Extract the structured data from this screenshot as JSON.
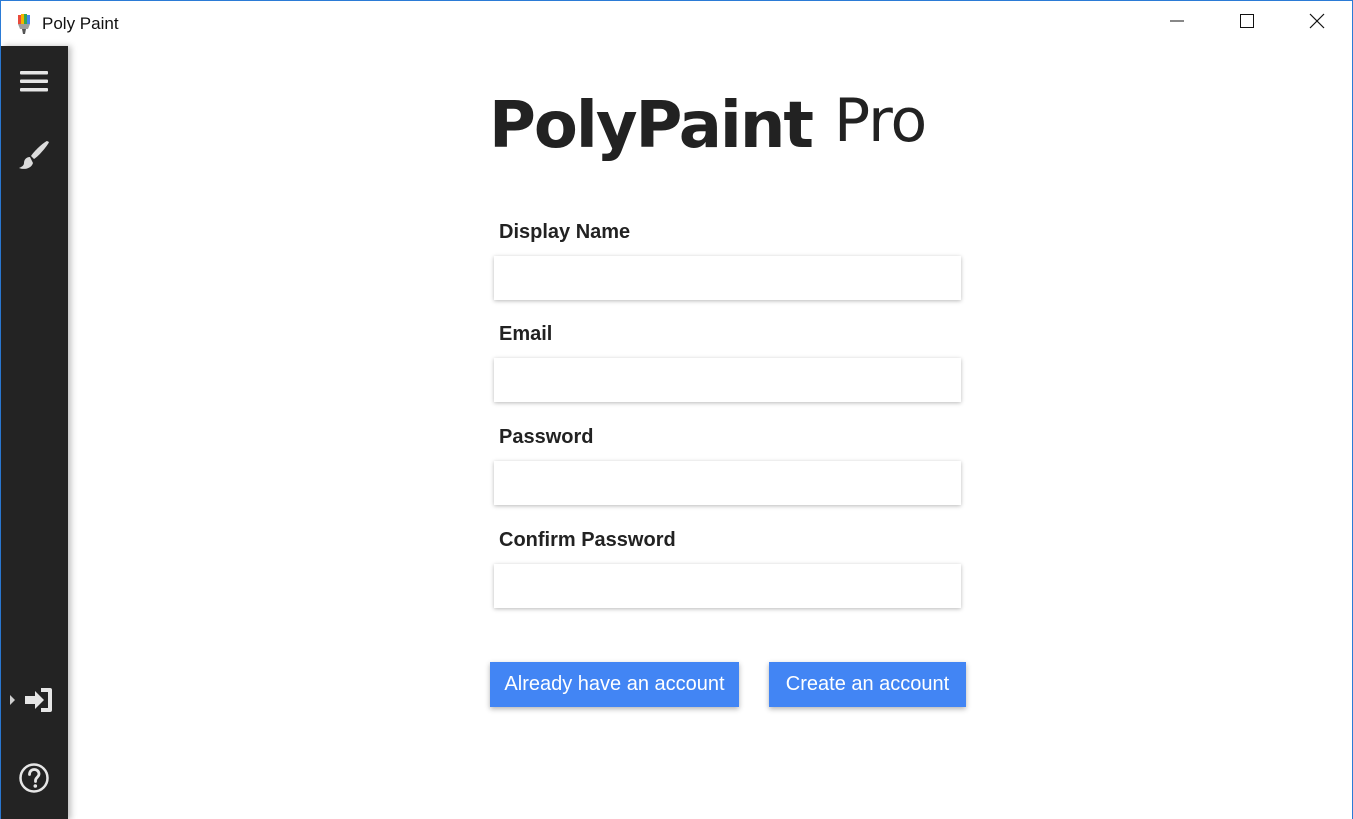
{
  "window": {
    "title": "Poly Paint",
    "app_icon": "palette-icon",
    "controls": [
      "minimize-icon",
      "maximize-icon",
      "close-icon"
    ]
  },
  "sidebar": {
    "top_items": [
      {
        "icon": "menu-icon"
      },
      {
        "icon": "brush-icon"
      }
    ],
    "bottom_items": [
      {
        "icon": "login-icon"
      },
      {
        "icon": "help-icon"
      }
    ]
  },
  "logo": {
    "bold": "PolyPaint",
    "light": "Pro"
  },
  "form": {
    "display_name": {
      "label": "Display Name",
      "value": ""
    },
    "email": {
      "label": "Email",
      "value": ""
    },
    "password": {
      "label": "Password",
      "value": ""
    },
    "confirm_password": {
      "label": "Confirm Password",
      "value": ""
    }
  },
  "actions": {
    "have_account": "Already have an account",
    "create_account": "Create an account"
  },
  "colors": {
    "accent": "#4285f4",
    "sidebar_bg": "#232323",
    "window_border": "#2b7bd6"
  }
}
